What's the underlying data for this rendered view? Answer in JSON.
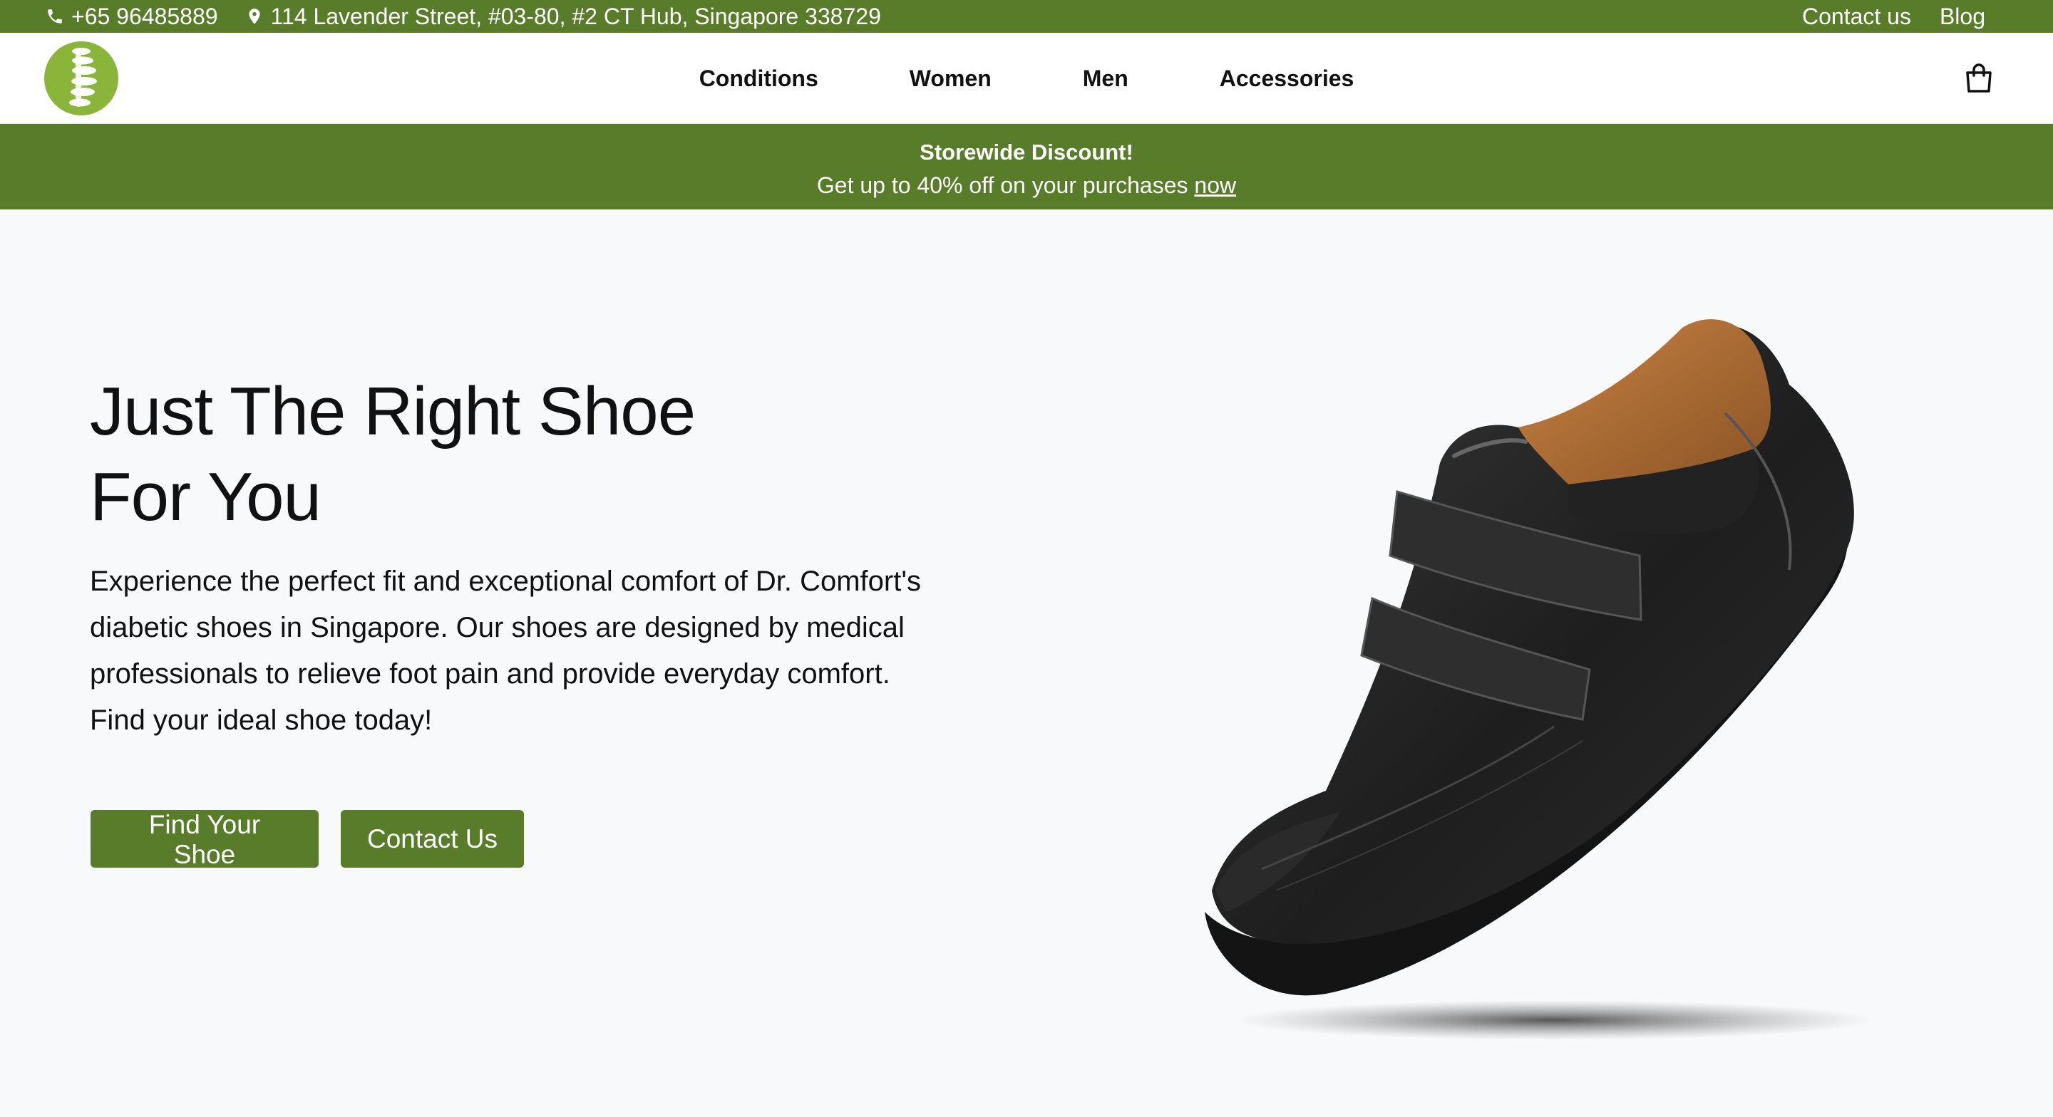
{
  "topbar": {
    "phone": "+65 96485889",
    "address": "114 Lavender Street, #03-80, #2 CT Hub, Singapore 338729",
    "links": [
      "Contact us",
      "Blog"
    ]
  },
  "nav": {
    "items": [
      "Conditions",
      "Women",
      "Men",
      "Accessories"
    ]
  },
  "promo": {
    "title": "Storewide Discount!",
    "text": "Get up to 40% off on your purchases",
    "link": "now"
  },
  "hero": {
    "title_line1": "Just The Right Shoe",
    "title_line2": "For You",
    "description": "Experience the perfect fit and exceptional comfort of Dr. Comfort's diabetic shoes in Singapore. Our shoes are designed by medical professionals to relieve foot pain and provide everyday comfort. Find your ideal shoe today!",
    "primary_button": "Find Your Shoe",
    "secondary_button": "Contact Us"
  },
  "colors": {
    "brand_green": "#587c2a",
    "logo_green": "#8ab43a",
    "background": "#f8f9fb"
  },
  "icons": [
    "phone-icon",
    "location-pin-icon",
    "spine-logo-icon",
    "shopping-bag-icon"
  ]
}
